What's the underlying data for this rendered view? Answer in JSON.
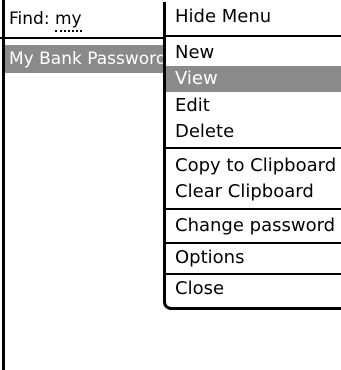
{
  "find": {
    "label": "Find:",
    "value": "my"
  },
  "list": {
    "items": [
      {
        "label": "My Bank Password"
      }
    ]
  },
  "menu": {
    "items": [
      {
        "label": "Hide Menu"
      },
      {
        "label": "New"
      },
      {
        "label": "View",
        "selected": true
      },
      {
        "label": "Edit"
      },
      {
        "label": "Delete"
      },
      {
        "label": "Copy to Clipboard"
      },
      {
        "label": "Clear Clipboard"
      },
      {
        "label": "Change password"
      },
      {
        "label": "Options"
      },
      {
        "label": "Close"
      }
    ]
  },
  "colors": {
    "selection": "#8a8a8a",
    "text": "#000000",
    "background": "#ffffff"
  }
}
